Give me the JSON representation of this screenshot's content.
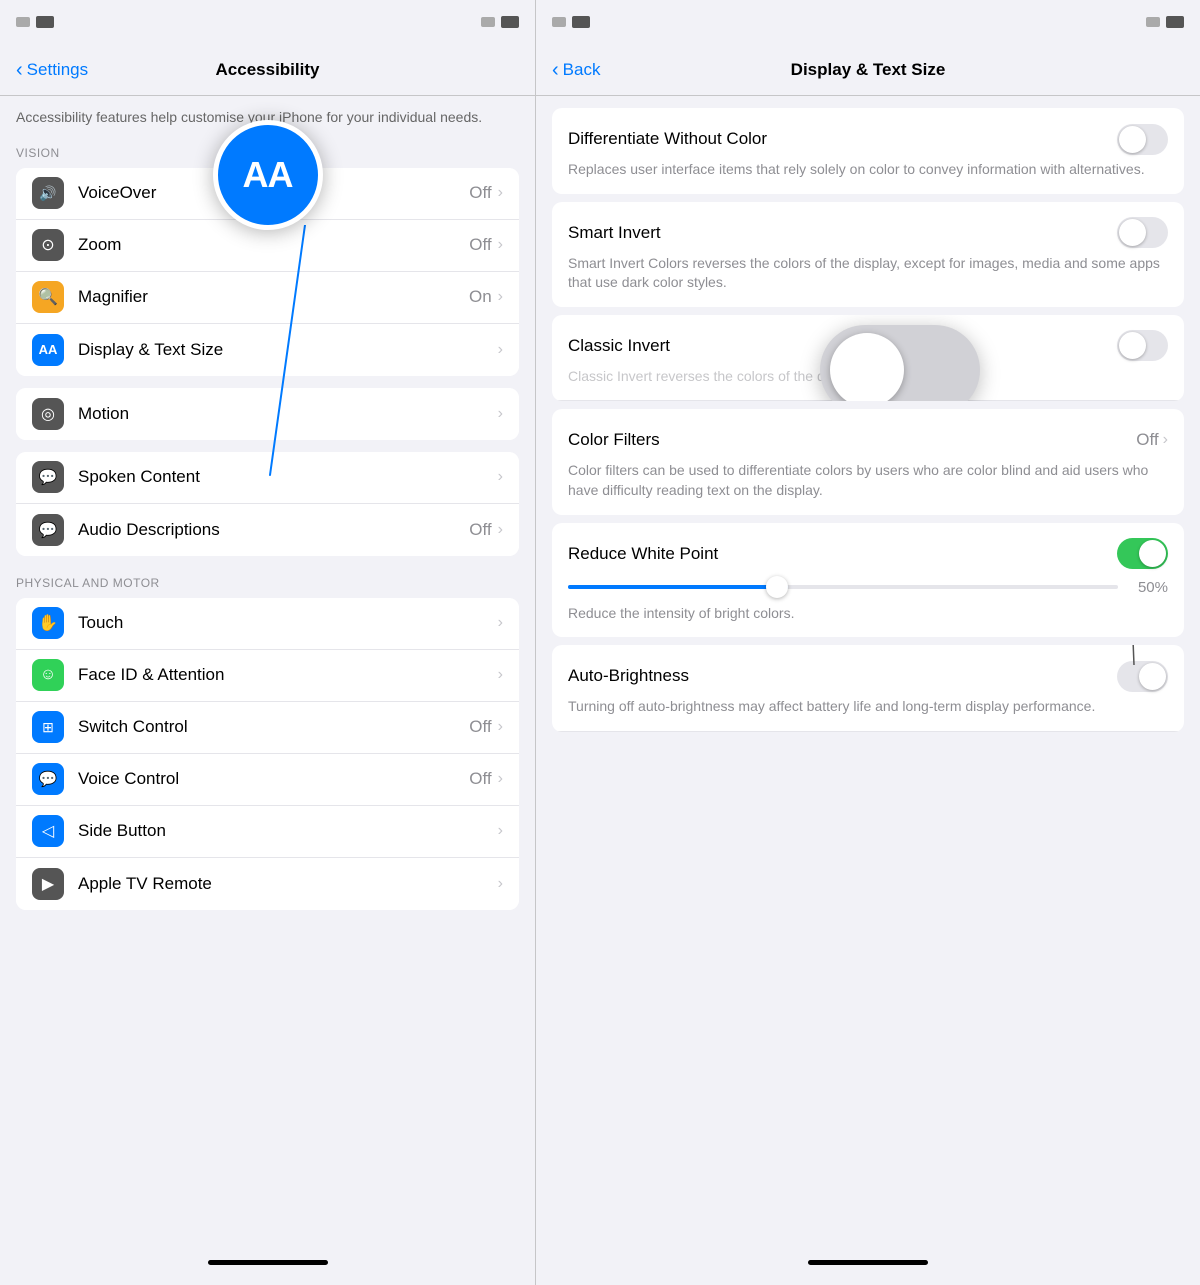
{
  "left": {
    "status_bar": {
      "left_rect": "■",
      "right_rect": "■"
    },
    "nav": {
      "back_label": "Settings",
      "title": "Accessibility"
    },
    "description": "Accessibility features help customise your iPhone for your individual needs.",
    "sections": [
      {
        "id": "vision",
        "header": "VISION",
        "items": [
          {
            "id": "voiceover",
            "label": "VoiceOver",
            "value": "Off",
            "has_chevron": true,
            "icon_color": "#555555",
            "icon_symbol": "🔊"
          },
          {
            "id": "zoom",
            "label": "Zoom",
            "value": "Off",
            "has_chevron": true,
            "icon_color": "#555555",
            "icon_symbol": "⊙"
          },
          {
            "id": "magnifier",
            "label": "Magnifier",
            "value": "On",
            "has_chevron": true,
            "icon_color": "#f5a623",
            "icon_symbol": "🔍"
          },
          {
            "id": "display-text-size",
            "label": "Display & Text Size",
            "value": "",
            "has_chevron": true,
            "icon_color": "#007aff",
            "icon_symbol": "AA",
            "selected": true
          }
        ]
      },
      {
        "id": "motion",
        "header": "",
        "items": [
          {
            "id": "motion",
            "label": "Motion",
            "value": "",
            "has_chevron": true,
            "icon_color": "#555555",
            "icon_symbol": "◎"
          }
        ]
      },
      {
        "id": "spoken",
        "header": "",
        "items": [
          {
            "id": "spoken-content",
            "label": "Spoken Content",
            "value": "",
            "has_chevron": true,
            "icon_color": "#555555",
            "icon_symbol": "💬"
          },
          {
            "id": "audio-descriptions",
            "label": "Audio Descriptions",
            "value": "Off",
            "has_chevron": true,
            "icon_color": "#555555",
            "icon_symbol": "💬"
          }
        ]
      },
      {
        "id": "physical",
        "header": "PHYSICAL AND MOTOR",
        "items": [
          {
            "id": "touch",
            "label": "Touch",
            "value": "",
            "has_chevron": true,
            "icon_color": "#007aff",
            "icon_symbol": "✋"
          },
          {
            "id": "faceid",
            "label": "Face ID & Attention",
            "value": "",
            "has_chevron": true,
            "icon_color": "#30d158",
            "icon_symbol": "☺"
          },
          {
            "id": "switch-control",
            "label": "Switch Control",
            "value": "Off",
            "has_chevron": true,
            "icon_color": "#007aff",
            "icon_symbol": "⊞"
          },
          {
            "id": "voice-control",
            "label": "Voice Control",
            "value": "Off",
            "has_chevron": true,
            "icon_color": "#007aff",
            "icon_symbol": "💬"
          },
          {
            "id": "side-button",
            "label": "Side Button",
            "value": "",
            "has_chevron": true,
            "icon_color": "#007aff",
            "icon_symbol": "◁"
          },
          {
            "id": "appletv-remote",
            "label": "Apple TV Remote",
            "value": "",
            "has_chevron": true,
            "icon_color": "#555555",
            "icon_symbol": "▶"
          }
        ]
      }
    ],
    "aa_overlay": {
      "text": "AA"
    }
  },
  "right": {
    "status_bar": {
      "left_rect": "■",
      "right_rect": "■"
    },
    "nav": {
      "back_label": "Back",
      "title": "Display & Text Size"
    },
    "items": [
      {
        "id": "differentiate-without-color",
        "title": "Differentiate Without Color",
        "desc": "Replaces user interface items that rely solely on color to convey information with alternatives.",
        "toggle": "off",
        "show_toggle": true
      },
      {
        "id": "smart-invert",
        "title": "Smart Invert",
        "desc": "Smart Invert Colors reverses the colors of the display, except for images, media and some apps that use dark color styles.",
        "toggle": "off",
        "show_toggle": true
      },
      {
        "id": "classic-invert",
        "title": "Classic Invert",
        "desc": "Classic Invert reverses the colors of the display.",
        "toggle": "off",
        "show_toggle": true
      },
      {
        "id": "color-filters",
        "title": "Color Filters",
        "value": "Off",
        "desc": "Color filters can be used to differentiate colors by users who are color blind and aid users who have difficulty reading text on the display.",
        "show_chevron": true,
        "show_toggle": false
      },
      {
        "id": "reduce-white-point",
        "title": "Reduce White Point",
        "desc": "Reduce the intensity of bright colors.",
        "toggle": "on",
        "show_toggle": true,
        "show_slider": true,
        "slider_value": "50%",
        "slider_fill_pct": 40
      },
      {
        "id": "auto-brightness",
        "title": "Auto-Brightness",
        "desc": "Turning off auto-brightness may affect battery life and long-term display performance.",
        "toggle": "off",
        "show_toggle": true
      }
    ]
  }
}
